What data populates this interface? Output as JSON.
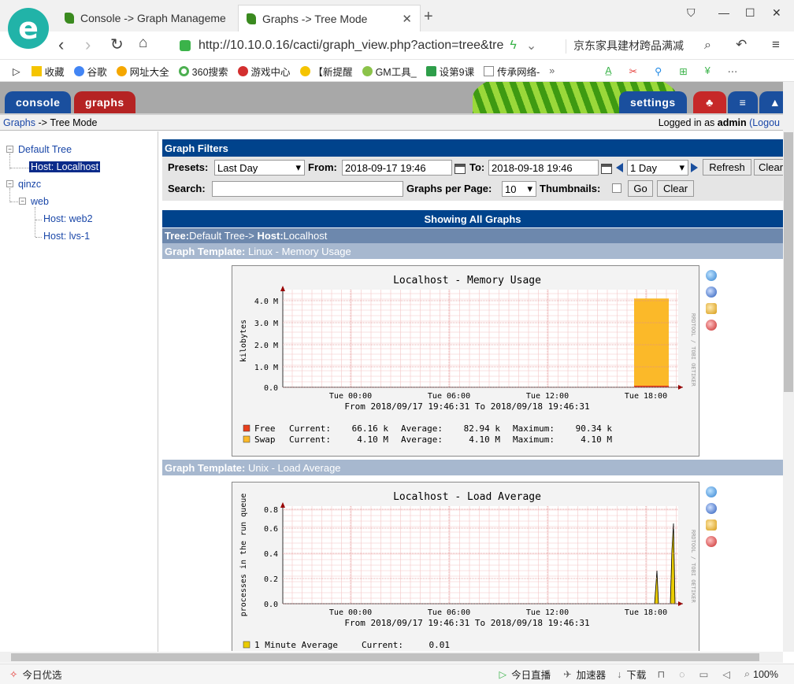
{
  "browser": {
    "tabs": [
      {
        "label": "Console -> Graph Manageme",
        "active": false
      },
      {
        "label": "Graphs -> Tree Mode",
        "active": true
      }
    ],
    "url": "http://10.10.0.16/cacti/graph_view.php?action=tree&tre",
    "search_text": "京东家具建材跨品满减",
    "bookmarks": [
      "收藏",
      "谷歌",
      "网址大全",
      "360搜索",
      "游戏中心",
      "【新提醒",
      "GM工具_",
      "设第9课",
      "传承网络-"
    ],
    "status_left": "今日优选",
    "status_right": [
      "今日直播",
      "加速器",
      "下载",
      "100%"
    ]
  },
  "cacti": {
    "tabs": [
      "console",
      "graphs",
      "settings"
    ],
    "breadcrumb": {
      "root": "Graphs",
      "sep": "->",
      "current": "Tree Mode"
    },
    "login": {
      "prefix": "Logged in as",
      "user": "admin",
      "logout": "(Logou"
    }
  },
  "tree": {
    "nodes": [
      {
        "label": "Default Tree",
        "level": 0
      },
      {
        "label": "Host: Localhost",
        "level": 1,
        "selected": true
      },
      {
        "label": "qinzc",
        "level": 0
      },
      {
        "label": "web",
        "level": 1
      },
      {
        "label": "Host: web2",
        "level": 2
      },
      {
        "label": "Host: lvs-1",
        "level": 2
      }
    ]
  },
  "filters": {
    "title": "Graph Filters",
    "presets_label": "Presets:",
    "presets_value": "Last Day",
    "from_label": "From:",
    "from_value": "2018-09-17 19:46",
    "to_label": "To:",
    "to_value": "2018-09-18 19:46",
    "span_value": "1 Day",
    "refresh_label": "Refresh",
    "clear1_label": "Clear",
    "search_label": "Search:",
    "search_value": "",
    "per_page_label": "Graphs per Page:",
    "per_page_value": "10",
    "thumbnails_label": "Thumbnails:",
    "go_label": "Go",
    "clear2_label": "Clear"
  },
  "listing": {
    "showing": "Showing All Graphs",
    "tree_prefix": "Tree:",
    "tree_name": "Default Tree->",
    "host_prefix": "Host:",
    "host_name": "Localhost"
  },
  "graphs": [
    {
      "template_label": "Graph Template:",
      "template_name": "Linux - Memory Usage",
      "title": "Localhost - Memory Usage",
      "ylabel": "kilobytes",
      "yticks": [
        "4.0 M",
        "3.0 M",
        "2.0 M",
        "1.0 M",
        "0.0"
      ],
      "xticks": [
        "Tue 00:00",
        "Tue 06:00",
        "Tue 12:00",
        "Tue 18:00"
      ],
      "range": "From 2018/09/17 19:46:31 To 2018/09/18 19:46:31",
      "watermark": "RRDTOOL / TOBI OETIKER",
      "legend": [
        {
          "name": "Free",
          "color": "#e8401c",
          "current": "66.16 k",
          "average": "82.94 k",
          "maximum": "90.34 k"
        },
        {
          "name": "Swap",
          "color": "#fbb929",
          "current": "4.10 M",
          "average": "4.10 M",
          "maximum": "4.10 M"
        }
      ]
    },
    {
      "template_label": "Graph Template:",
      "template_name": "Unix - Load Average",
      "title": "Localhost - Load Average",
      "ylabel": "processes in the run queue",
      "yticks": [
        "0.8",
        "0.6",
        "0.4",
        "0.2",
        "0.0"
      ],
      "xticks": [
        "Tue 00:00",
        "Tue 06:00",
        "Tue 12:00",
        "Tue 18:00"
      ],
      "range": "From 2018/09/17 19:46:31 To 2018/09/18 19:46:31",
      "watermark": "RRDTOOL / TOBI OETIKER",
      "legend": [
        {
          "name": "1 Minute Average",
          "color": "#eacc00",
          "current": "0.01"
        }
      ]
    }
  ],
  "legend_labels": {
    "current": "Current:",
    "average": "Average:",
    "maximum": "Maximum:"
  }
}
